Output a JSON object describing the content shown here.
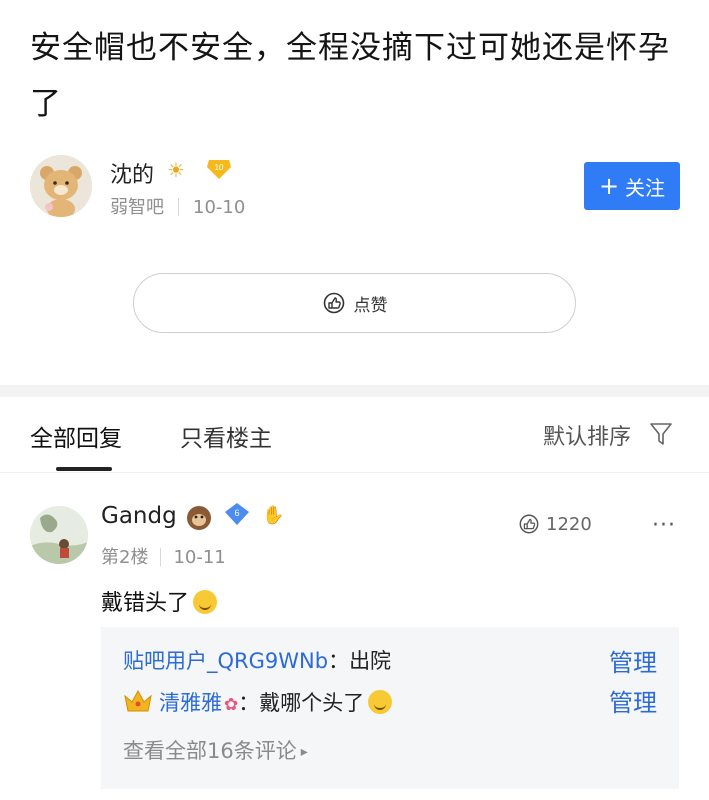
{
  "post": {
    "title": "安全帽也不安全，全程没摘下过可她还是怀孕了"
  },
  "author": {
    "name": "沈的",
    "forum": "弱智吧",
    "date": "10-10",
    "level": "10",
    "follow_label": "关注"
  },
  "like_button": {
    "label": "点赞"
  },
  "tabs": {
    "all": "全部回复",
    "op_only": "只看楼主",
    "sort": "默认排序"
  },
  "reply": {
    "username": "Gandg",
    "level": "6",
    "floor": "第2楼",
    "date": "10-11",
    "likes": "1220",
    "content": "戴错头了",
    "subreplies": [
      {
        "user": "贴吧用户_QRG9WNb",
        "sep": "：",
        "text": "出院",
        "manage": "管理"
      },
      {
        "user": "清雅雅",
        "sep": "：",
        "text": "戴哪个头了",
        "manage": "管理"
      }
    ],
    "view_all": "查看全部16条评论"
  },
  "colors": {
    "accent": "#2f7cf6",
    "link": "#2b6bd6"
  }
}
